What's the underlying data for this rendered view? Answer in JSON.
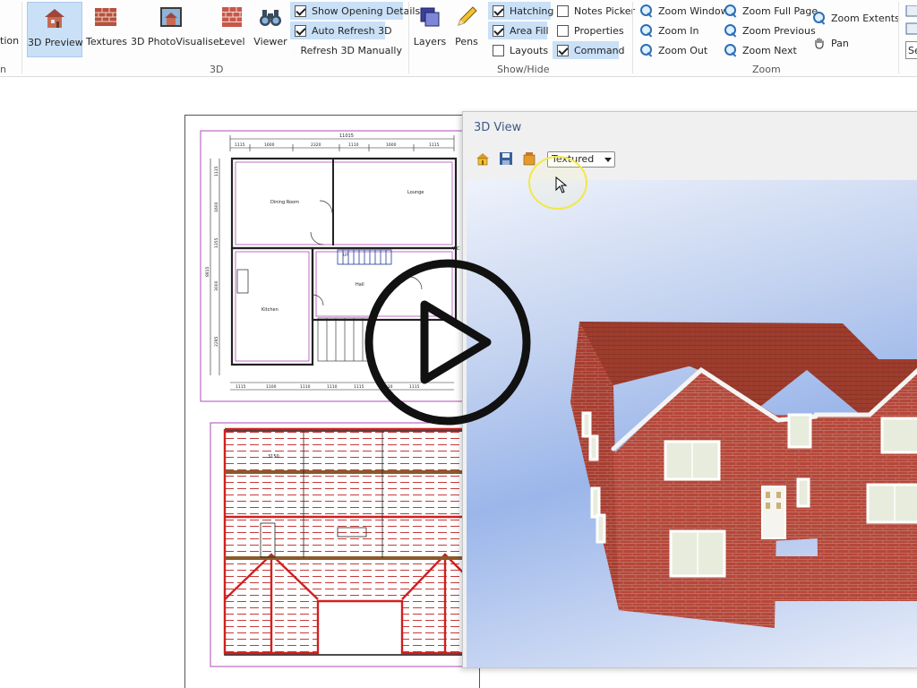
{
  "ribbon": {
    "partial_left_label": "tion",
    "partial_left_group": "n",
    "groups": {
      "threed": "3D",
      "showhide": "Show/Hide",
      "zoom": "Zoom"
    },
    "buttons": {
      "preview_3d": "3D Preview",
      "textures": "Textures",
      "photovisualiser": "3D PhotoVisualiser",
      "level": "Level",
      "viewer": "Viewer",
      "layers": "Layers",
      "pens": "Pens"
    },
    "options_3d": {
      "show_opening_details": "Show Opening Details",
      "auto_refresh": "Auto Refresh 3D",
      "refresh_manually": "Refresh 3D Manually"
    },
    "show_hide": {
      "hatching": "Hatching",
      "area_fill": "Area Fill",
      "layouts": "Layouts",
      "notes_picker": "Notes Picker",
      "properties": "Properties",
      "command": "Command"
    },
    "zoom": {
      "window": "Zoom Window",
      "in": "Zoom In",
      "out": "Zoom Out",
      "full_page": "Zoom Full Page",
      "previous": "Zoom Previous",
      "next": "Zoom Next",
      "extents": "Zoom Extents",
      "pan": "Pan"
    },
    "partial_right": "Se"
  },
  "plan": {
    "top_overall": "11015",
    "top_dims": [
      "1115",
      "1600",
      "2320",
      "1110",
      "1600",
      "1115"
    ],
    "bottom_dims": [
      "1115",
      "1100",
      "1110",
      "1110",
      "1115",
      "1110",
      "1115"
    ],
    "left_dims": [
      "1115",
      "1600",
      "1355",
      "3000",
      "2285"
    ],
    "left_total": "8815",
    "rooms": {
      "dining": "Dining Room",
      "lounge": "Lounge",
      "kitchen": "Kitchen",
      "hall": "Hall",
      "wc": "WC",
      "up": "UP"
    },
    "upper_dim": "3150"
  },
  "view3d": {
    "title": "3D View",
    "render_mode": "Textured"
  },
  "colors": {
    "ribbon_active": "#c9e0f7",
    "brick": "#b5473a",
    "roof": "#9b3a2c",
    "plan_magenta": "#b04ab8",
    "hatch_red": "#d11f1f",
    "timber_brown": "#8a5a2b"
  }
}
